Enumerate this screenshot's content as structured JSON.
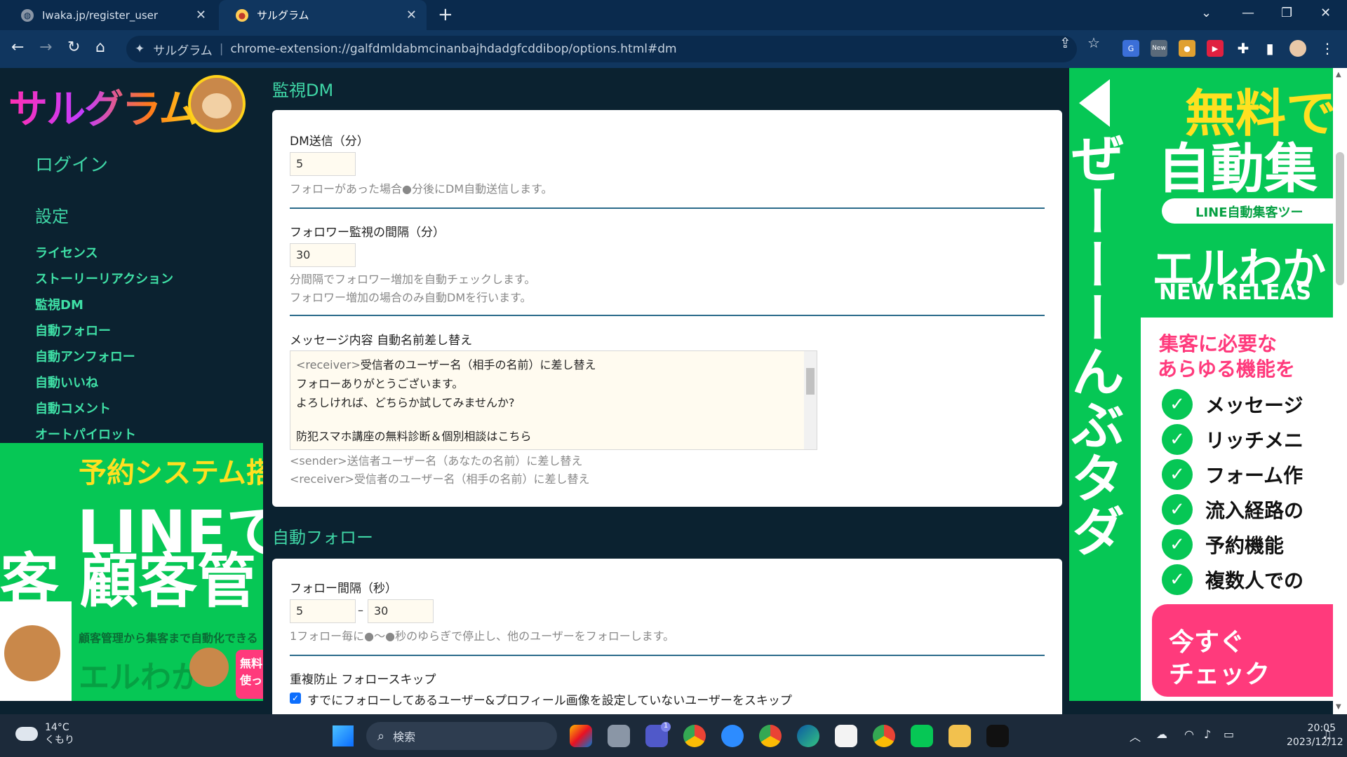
{
  "browser": {
    "tabs": [
      {
        "title": "Iwaka.jp/register_user",
        "active": false
      },
      {
        "title": "サルグラム",
        "active": true
      }
    ],
    "site_chip": "サルグラム",
    "url": "chrome-extension://galfdmldabmcinanbajhdadgfcddibop/options.html#dm",
    "new_badge": "New"
  },
  "sidebar": {
    "logo_text": "サルグラム",
    "login": "ログイン",
    "settings": "設定",
    "items": [
      {
        "label": "ライセンス"
      },
      {
        "label": "ストーリーリアクション"
      },
      {
        "label": "監視DM"
      },
      {
        "label": "自動フォロー"
      },
      {
        "label": "自動アンフォロー"
      },
      {
        "label": "自動いいね"
      },
      {
        "label": "自動コメント"
      },
      {
        "label": "オートパイロット"
      }
    ]
  },
  "ad_left": {
    "line1": "予約システム搭",
    "line2": "LINEで",
    "line3": "客 顧客管",
    "line4": "顧客管理から集客まで自動化できる",
    "line5": "エルわか",
    "badge": "無料 使っ"
  },
  "dm_section": {
    "title": "監視DM",
    "dm_send_label": "DM送信（分）",
    "dm_send_value": "5",
    "dm_send_hint": "フォローがあった場合●分後にDM自動送信します。",
    "monitor_label": "フォロワー監視の間隔（分）",
    "monitor_value": "30",
    "monitor_hint1": "分間隔でフォロワー増加を自動チェックします。",
    "monitor_hint2": "フォロワー増加の場合のみ自動DMを行います。",
    "message_label": "メッセージ内容 自動名前差し替え",
    "message_lines": [
      {
        "tag": "<receiver>",
        "text": "受信者のユーザー名（相手の名前）に差し替え"
      },
      {
        "tag": "",
        "text": "フォローありがとうございます。"
      },
      {
        "tag": "",
        "text": "よろしければ、どちらか試してみませんか?"
      },
      {
        "tag": "",
        "text": ""
      },
      {
        "tag": "",
        "text": "防犯スマホ講座の無料診断＆個別相談はこちら"
      }
    ],
    "sender_hint": "<sender>送信者ユーザー名（あなたの名前）に差し替え",
    "receiver_hint": "<receiver>受信者のユーザー名（相手の名前）に差し替え"
  },
  "follow_section": {
    "title": "自動フォロー",
    "interval_label": "フォロー間隔（秒）",
    "interval_min": "5",
    "dash": "–",
    "interval_max": "30",
    "interval_hint": "1フォロー毎に●～●秒のゆらぎで停止し、他のユーザーをフォローします。",
    "dup_label": "重複防止 フォロースキップ",
    "skip_checkbox_label": "すでにフォローしてあるユーザー&プロフィール画像を設定していないユーザーをスキップ",
    "skip_checked": true
  },
  "ad_right": {
    "vertical_text": "ぜーーーんぶタダ",
    "headline1": "無料で",
    "headline2": "自動集",
    "pill": "LINE自動集客ツー",
    "brand": "エルわか",
    "release": "NEW RELEAS",
    "need1": "集客に必要な",
    "need2": "あらゆる機能を",
    "features": [
      "メッセージ",
      "リッチメニ",
      "フォーム作",
      "流入経路の",
      "予約機能",
      "複数人での"
    ],
    "cta1": "今すぐ",
    "cta2": "チェック"
  },
  "taskbar": {
    "temp": "14°C",
    "condition": "くもり",
    "search_placeholder": "検索",
    "teams_badge": "1",
    "time": "20:05",
    "date": "2023/12/12"
  },
  "colors": {
    "accent": "#3fd6a6",
    "line_green": "#06c755",
    "pink": "#ff3a7c"
  }
}
